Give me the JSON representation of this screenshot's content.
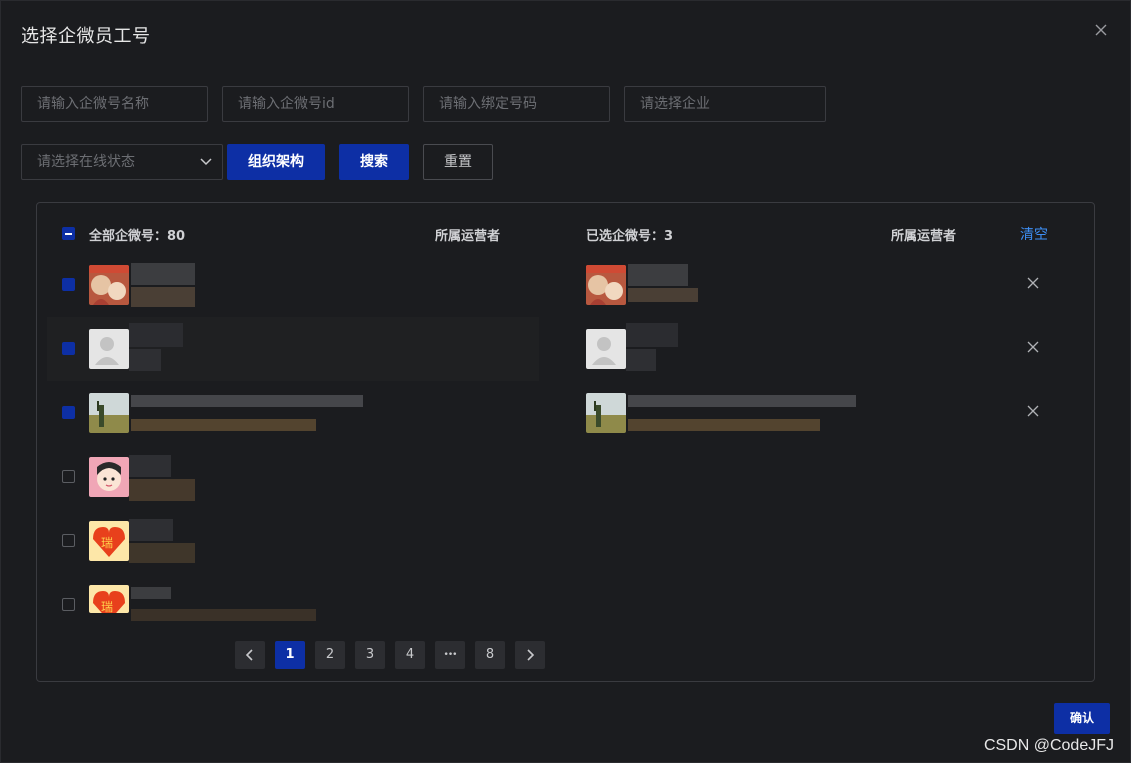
{
  "dialog": {
    "title": "选择企微员工号"
  },
  "filters": {
    "name_placeholder": "请输入企微号名称",
    "id_placeholder": "请输入企微号id",
    "bind_placeholder": "请输入绑定号码",
    "company_placeholder": "请选择企业",
    "status_placeholder": "请选择在线状态",
    "org_button": "组织架构",
    "search_button": "搜索",
    "reset_button": "重置"
  },
  "left_list": {
    "header": "全部企微号：80",
    "operator_header": "所属运营者",
    "rows": [
      {
        "checked": true,
        "avatar": "couple-photo"
      },
      {
        "checked": true,
        "avatar": "default-user"
      },
      {
        "checked": true,
        "avatar": "landscape-photo"
      },
      {
        "checked": false,
        "avatar": "cartoon-girl"
      },
      {
        "checked": false,
        "avatar": "red-heart-logo"
      },
      {
        "checked": false,
        "avatar": "red-heart-logo"
      }
    ]
  },
  "right_list": {
    "header": "已选企微号：3",
    "operator_header": "所属运营者",
    "clear_label": "清空",
    "rows": [
      {
        "avatar": "couple-photo"
      },
      {
        "avatar": "default-user"
      },
      {
        "avatar": "landscape-photo"
      }
    ]
  },
  "pagination": {
    "pages": [
      "1",
      "2",
      "3",
      "4",
      "•••",
      "8"
    ],
    "current": "1"
  },
  "footer": {
    "confirm_label": "确认"
  },
  "watermark": "CSDN @CodeJFJ",
  "colors": {
    "background": "#1b1c1f",
    "primary": "#0d2fa5",
    "link": "#3e8ff5",
    "border": "#3a3b40"
  }
}
